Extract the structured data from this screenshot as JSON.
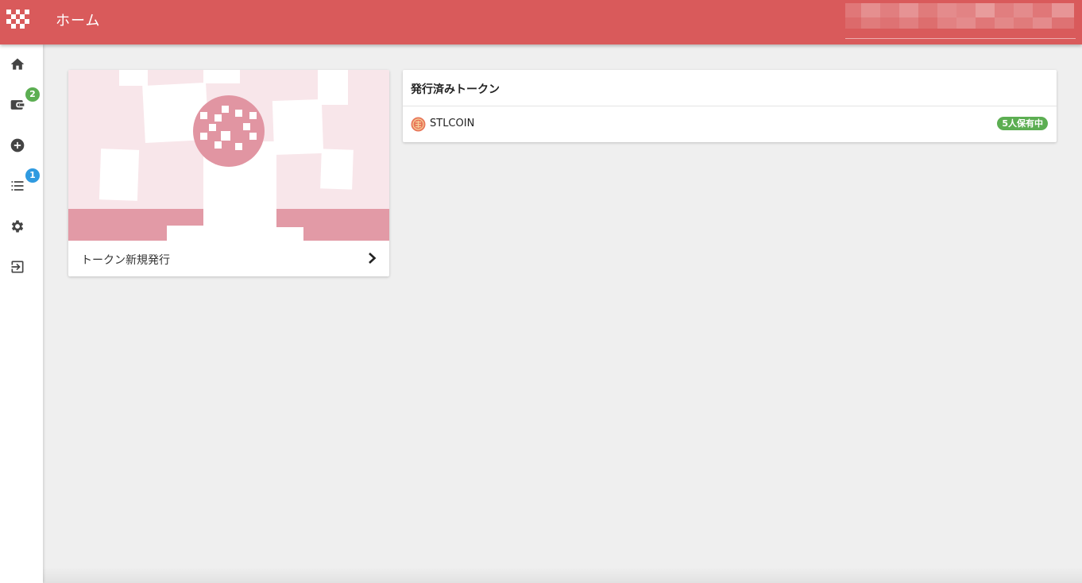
{
  "header": {
    "title": "ホーム",
    "logo_icon": "checker-logo-icon",
    "user_info": "",
    "color": "#d95a5b"
  },
  "sidebar": {
    "items": [
      {
        "name": "home",
        "icon": "home-icon"
      },
      {
        "name": "wallet",
        "icon": "wallet-icon",
        "badge": "2",
        "badge_color": "#5cae52"
      },
      {
        "name": "create",
        "icon": "add-circle-icon"
      },
      {
        "name": "list",
        "icon": "list-icon",
        "badge": "1",
        "badge_color": "#2f9ae0"
      },
      {
        "name": "settings",
        "icon": "gear-icon"
      },
      {
        "name": "logout",
        "icon": "logout-icon"
      }
    ]
  },
  "new_token_card": {
    "label": "トークン新規発行",
    "action_icon": "chevron-right-icon"
  },
  "issued_tokens": {
    "title": "発行済みトークン",
    "items": [
      {
        "name": "STLCOIN",
        "holders_badge": "5人保有中",
        "icon": "coin-icon"
      }
    ]
  }
}
